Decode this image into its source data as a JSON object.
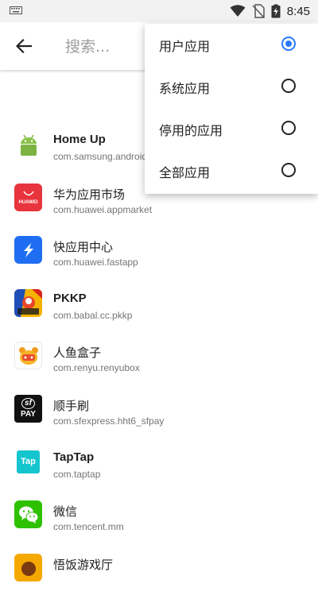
{
  "status_bar": {
    "time": "8:45"
  },
  "toolbar": {
    "search_placeholder": "搜索..."
  },
  "filter_menu": {
    "options": [
      {
        "label": "用户应用",
        "checked": true
      },
      {
        "label": "系统应用",
        "checked": false
      },
      {
        "label": "停用的应用",
        "checked": false
      },
      {
        "label": "全部应用",
        "checked": false
      }
    ]
  },
  "apps": [
    {
      "name": "Home Up",
      "package": "com.samsung.android.homeup"
    },
    {
      "name": "华为应用市场",
      "package": "com.huawei.appmarket",
      "icon_text": "HUAWEI"
    },
    {
      "name": "快应用中心",
      "package": "com.huawei.fastapp"
    },
    {
      "name": "PKKP",
      "package": "com.babal.cc.pkkp"
    },
    {
      "name": "人鱼盒子",
      "package": "com.renyu.renyubox"
    },
    {
      "name": "顺手刷",
      "package": "com.sfexpress.hht6_sfpay",
      "icon_text_top": "sf",
      "icon_text_bottom": "PAY"
    },
    {
      "name": "TapTap",
      "package": "com.taptap",
      "icon_text": "Tap"
    },
    {
      "name": "微信",
      "package": "com.tencent.mm"
    },
    {
      "name": "悟饭游戏厅",
      "package": ""
    }
  ],
  "colors": {
    "accent": "#2979ff"
  }
}
